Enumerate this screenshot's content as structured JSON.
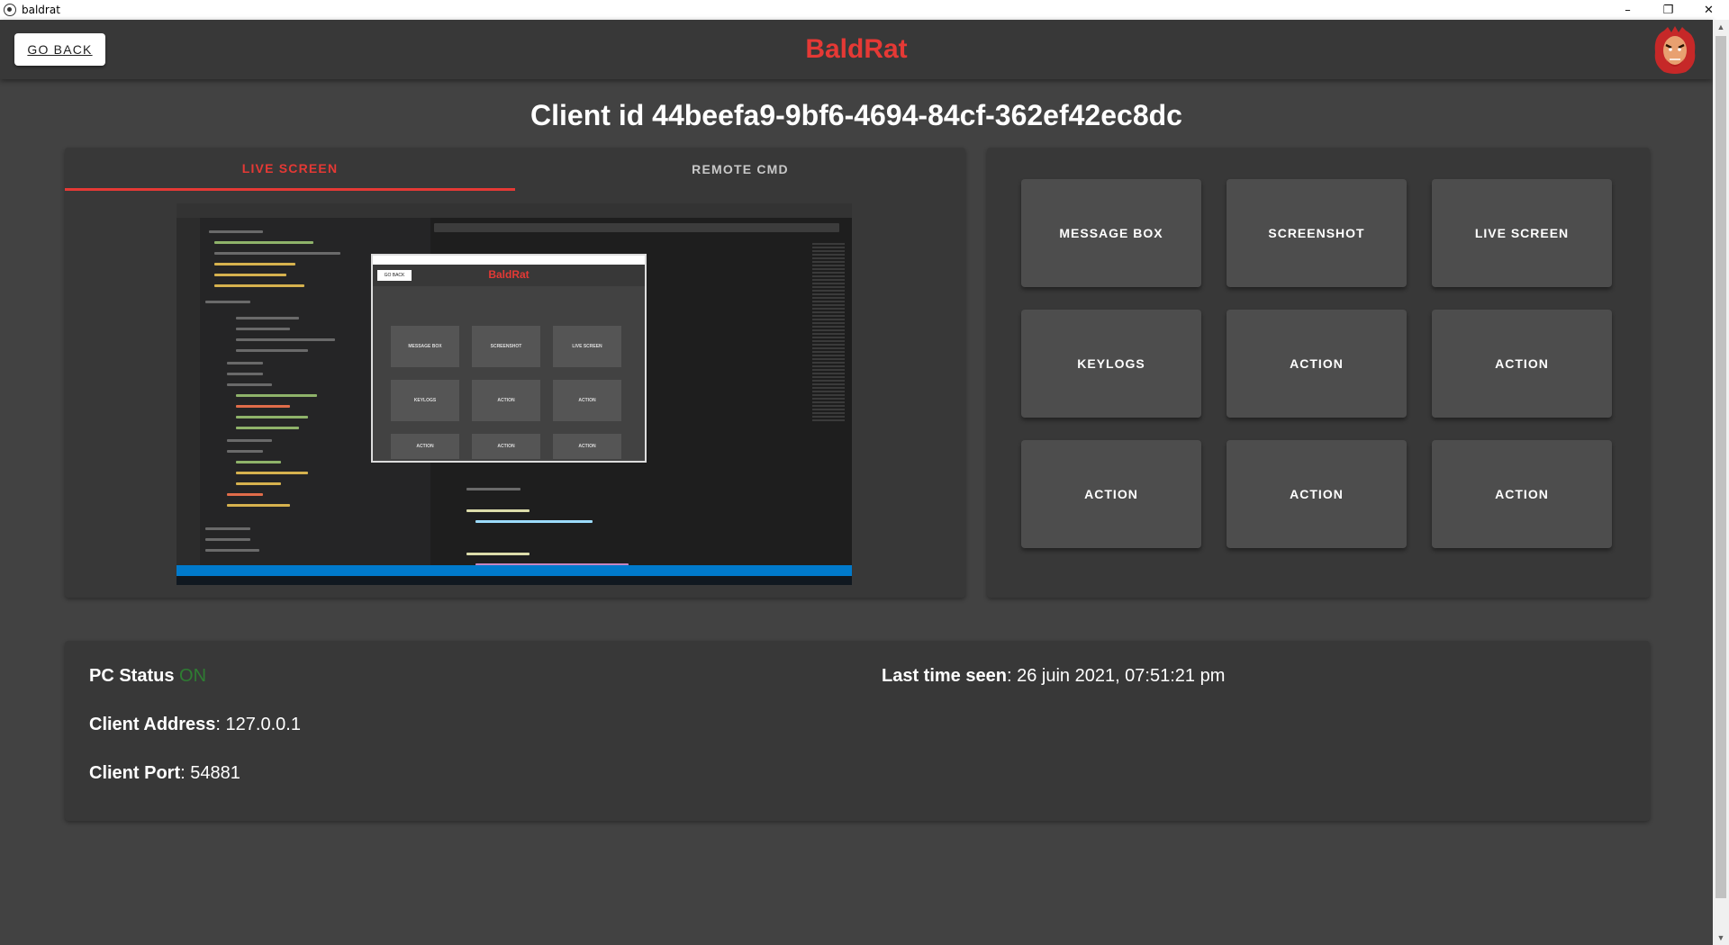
{
  "window": {
    "title": "baldrat",
    "controls": {
      "minimize": "–",
      "maximize": "❐",
      "close": "✕"
    }
  },
  "appbar": {
    "go_back_label": "GO BACK",
    "brand": "BaldRat",
    "logo_icon": "baldrat-logo-icon",
    "brand_color": "#e53935"
  },
  "page": {
    "client_id_label": "Client id",
    "client_id": "44beefa9-9bf6-4694-84cf-362ef42ec8dc"
  },
  "tabs": [
    {
      "label": "LIVE SCREEN",
      "active": true
    },
    {
      "label": "REMOTE CMD",
      "active": false
    }
  ],
  "live_screen_preview": {
    "popup_brand": "BaldRat",
    "popup_go_back": "GO BACK",
    "popup_buttons": [
      "MESSAGE BOX",
      "SCREENSHOT",
      "LIVE SCREEN",
      "KEYLOGS",
      "ACTION",
      "ACTION",
      "ACTION",
      "ACTION",
      "ACTION"
    ]
  },
  "actions": [
    "MESSAGE BOX",
    "SCREENSHOT",
    "LIVE SCREEN",
    "KEYLOGS",
    "ACTION",
    "ACTION",
    "ACTION",
    "ACTION",
    "ACTION"
  ],
  "status": {
    "pc_status_label": "PC Status",
    "pc_status_value": "ON",
    "pc_status_color": "#2e7d32",
    "last_seen_label": "Last time seen",
    "last_seen_value": "26 juin 2021, 07:51:21 pm",
    "address_label": "Client Address",
    "address_value": "127.0.0.1",
    "port_label": "Client Port",
    "port_value": "54881"
  }
}
